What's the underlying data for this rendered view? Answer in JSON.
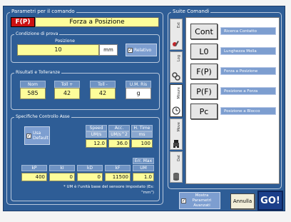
{
  "panel_left": {
    "title": "Parametri per il comando",
    "command_code": "F(P)",
    "command_name": "Forza a Posizione",
    "condition": {
      "title": "Condizione di prova",
      "field_label": "Posizione",
      "value": "10",
      "unit": "mm",
      "relative_label": "Relativo",
      "relative_checked": "✓"
    },
    "results": {
      "title": "Risultati e Tolleranze",
      "headers": [
        "Nom",
        "Toll +",
        "Toll -",
        "U.M. Ris"
      ],
      "values": [
        "585",
        "42",
        "42",
        "g"
      ]
    },
    "axis": {
      "title": "Specifiche Controllo Asse",
      "use_default_label": "Usa Default",
      "use_default_checked": "✓",
      "speed_headers": [
        "Speed",
        "Acc.",
        "H. Time"
      ],
      "speed_units": [
        "UM/s",
        "UM/s^2",
        "ms"
      ],
      "speed_values": [
        "12.0",
        "36.0",
        "100"
      ],
      "err_max_label": "Err. Max",
      "pid_headers": [
        "kP",
        "kI",
        "kD",
        "kF",
        "UM"
      ],
      "pid_values": [
        "400",
        "0",
        "0",
        "11500",
        "1.0"
      ],
      "note": "* UM è l'unità base del sensore impostato (Es: \"mm\")"
    }
  },
  "panel_right": {
    "title": "Suite Comandi",
    "tabs": [
      {
        "label": "Ext",
        "icon": "tools-icon"
      },
      {
        "label": "Log",
        "icon": "gears-icon"
      },
      {
        "label": "Misure",
        "icon": "clock-icon"
      },
      {
        "label": "Move",
        "icon": "robot-icon"
      },
      {
        "label": "Dat",
        "icon": "database-icon"
      }
    ],
    "commands": [
      {
        "code": "Cont",
        "label": "Ricerca Contatto"
      },
      {
        "code": "L0",
        "label": "Lunghezza Molla"
      },
      {
        "code": "F(P)",
        "label": "Forza a Posizione"
      },
      {
        "code": "P(F)",
        "label": "Posizione a Forza"
      },
      {
        "code": "Pc",
        "label": "Posizione a Blocco"
      }
    ]
  },
  "footer": {
    "show_advanced_label": "Mostra Parametri Avanzati",
    "show_advanced_checked": "✓",
    "cancel_label": "Annulla",
    "go_label": "GO!"
  },
  "colors": {
    "window_blue": "#2e5d96",
    "field_yellow": "#fdfd9a",
    "command_red": "#cc1111",
    "label_blue": "#7d9ed0"
  }
}
